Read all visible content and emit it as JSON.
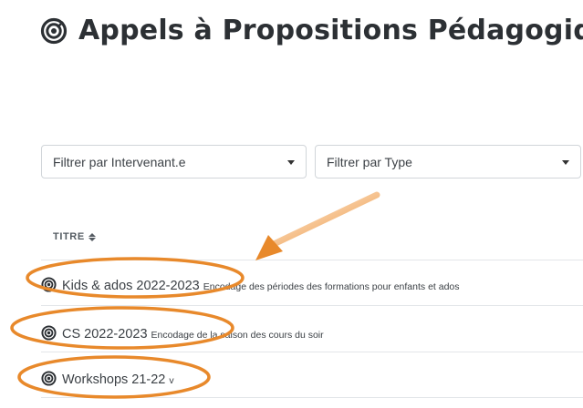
{
  "page": {
    "title": "Appels à Propositions Pédagogiques",
    "icon": "target-icon"
  },
  "filters": {
    "intervenant": {
      "selected": "Filtrer par Intervenant.e"
    },
    "type": {
      "selected": "Filtrer par Type"
    }
  },
  "table": {
    "column_header": "TITRE",
    "rows": [
      {
        "name": "Kids & ados 2022-2023",
        "description": "Encodage des périodes des formations pour enfants et ados"
      },
      {
        "name": "CS 2022-2023",
        "description": "Encodage de la saison des cours du soir"
      },
      {
        "name": "Workshops 21-22",
        "description": "v"
      }
    ]
  },
  "annotations": {
    "color": "#e8892b"
  },
  "colors": {
    "text": "#333a40",
    "border": "#d1d5d9",
    "divider": "#e3e6e9"
  }
}
